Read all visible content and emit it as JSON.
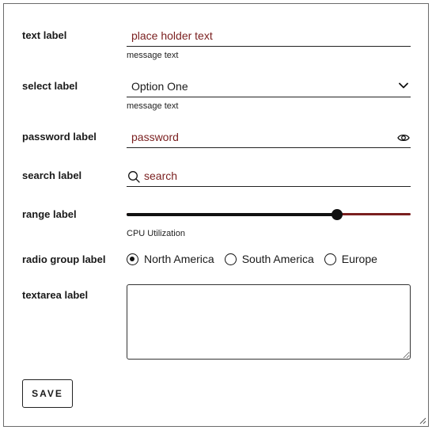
{
  "form": {
    "text": {
      "label": "text label",
      "placeholder": "place holder text",
      "message": "message text"
    },
    "select": {
      "label": "select label",
      "value": "Option One",
      "message": "message text"
    },
    "password": {
      "label": "password label",
      "placeholder": "password"
    },
    "search": {
      "label": "search label",
      "placeholder": "search"
    },
    "range": {
      "label": "range label",
      "value_fraction": 0.74,
      "message": "CPU Utilization"
    },
    "radio": {
      "label": "radio group label",
      "options": [
        {
          "label": "North America",
          "checked": true
        },
        {
          "label": "South America",
          "checked": false
        },
        {
          "label": "Europe",
          "checked": false
        }
      ]
    },
    "textarea": {
      "label": "textarea label",
      "value": ""
    },
    "save_label": "SAVE"
  },
  "colors": {
    "accent": "#7a1f1f",
    "ink": "#111111",
    "border": "#6b6b6b"
  },
  "icons": {
    "select": "chevron-down-icon",
    "password": "eye-icon",
    "search": "search-icon",
    "resize": "resize-grip-icon"
  }
}
